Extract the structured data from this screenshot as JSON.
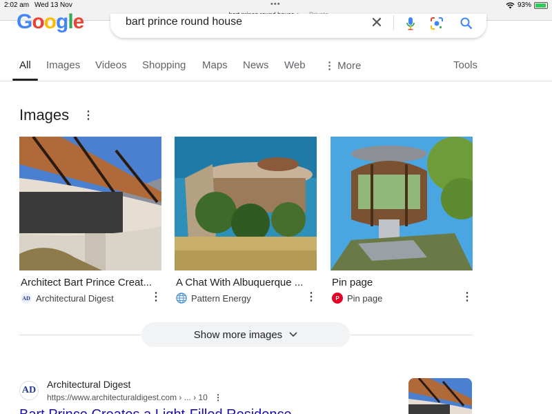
{
  "status_bar": {
    "time": "2:02 am",
    "date": "Wed 13 Nov",
    "url": "bart prince round house",
    "private_label": "— Private",
    "battery": "93%",
    "battery_level": 0.93
  },
  "logo": "Google",
  "search": {
    "query": "bart prince round house"
  },
  "tabs": [
    {
      "label": "All",
      "active": true
    },
    {
      "label": "Images"
    },
    {
      "label": "Videos"
    },
    {
      "label": "Shopping"
    },
    {
      "label": "Maps"
    },
    {
      "label": "News"
    },
    {
      "label": "Web"
    },
    {
      "label": "More"
    }
  ],
  "tools_label": "Tools",
  "images_section": {
    "title": "Images",
    "cards": [
      {
        "title": "Architect Bart Prince Creat...",
        "source": "Architectural Digest",
        "icon": "architectural-digest-favicon"
      },
      {
        "title": "A Chat With Albuquerque ...",
        "source": "Pattern Energy",
        "icon": "globe-icon"
      },
      {
        "title": "Pin page",
        "source": "Pin page",
        "icon": "pinterest-icon"
      }
    ],
    "show_more_label": "Show more images"
  },
  "result": {
    "favicon_text": "AD",
    "site": "Architectural Digest",
    "url": "https://www.architecturaldigest.com › ... › 10",
    "title": "Bart Prince Creates a Light-Filled Residence"
  },
  "colors": {
    "link": "#1a0dab",
    "google_blue": "#4285f4",
    "google_red": "#ea4335",
    "google_yellow": "#fbbc05",
    "google_green": "#34a853"
  }
}
